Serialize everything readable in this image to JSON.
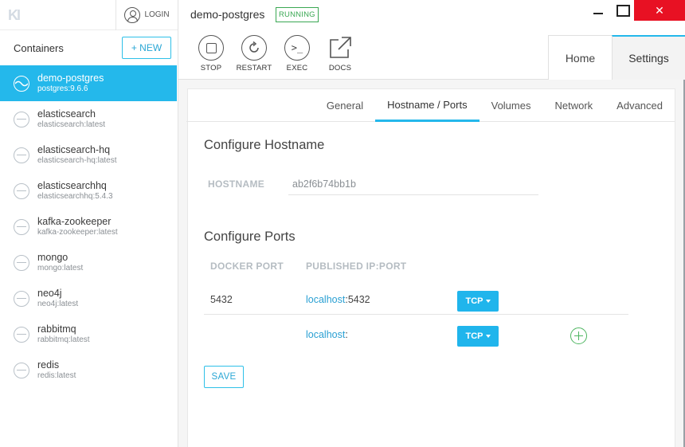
{
  "sidebar": {
    "logo": "KI",
    "login_label": "LOGIN",
    "containers_title": "Containers",
    "new_label": "+ NEW",
    "containers": [
      {
        "name": "demo-postgres",
        "image": "postgres:9.6.6",
        "active": true
      },
      {
        "name": "elasticsearch",
        "image": "elasticsearch:latest"
      },
      {
        "name": "elasticsearch-hq",
        "image": "elasticsearch-hq:latest"
      },
      {
        "name": "elasticsearchhq",
        "image": "elasticsearchhq:5.4.3"
      },
      {
        "name": "kafka-zookeeper",
        "image": "kafka-zookeeper:latest"
      },
      {
        "name": "mongo",
        "image": "mongo:latest"
      },
      {
        "name": "neo4j",
        "image": "neo4j:latest"
      },
      {
        "name": "rabbitmq",
        "image": "rabbitmq:latest"
      },
      {
        "name": "redis",
        "image": "redis:latest"
      }
    ]
  },
  "header": {
    "container_name": "demo-postgres",
    "status": "RUNNING",
    "status_color": "#3aa853",
    "close_glyph": "✕",
    "actions": [
      {
        "label": "STOP",
        "icon": "stop-icon"
      },
      {
        "label": "RESTART",
        "icon": "restart-icon"
      },
      {
        "label": "EXEC",
        "icon": "terminal-icon",
        "glyph": ">_"
      },
      {
        "label": "DOCS",
        "icon": "external-link-icon"
      }
    ],
    "tabs": [
      "Home",
      "Settings"
    ]
  },
  "settings": {
    "subtabs": [
      "General",
      "Hostname / Ports",
      "Volumes",
      "Network",
      "Advanced"
    ],
    "active_subtab": "Hostname / Ports",
    "hostname_section_title": "Configure Hostname",
    "hostname_label": "HOSTNAME",
    "hostname_value": "ab2f6b74bb1b",
    "ports_section_title": "Configure Ports",
    "col_docker_port": "DOCKER PORT",
    "col_published": "PUBLISHED IP:PORT",
    "ports": [
      {
        "docker_port": "5432",
        "host": "localhost",
        "sep": ":",
        "published_port": "5432",
        "protocol": "TCP"
      },
      {
        "docker_port": "",
        "host": "localhost",
        "sep": ":",
        "published_port": "",
        "protocol": "TCP"
      }
    ],
    "save_label": "SAVE"
  },
  "colors": {
    "accent": "#24b8eb",
    "close_red": "#e81123",
    "add_green": "#4db560"
  }
}
